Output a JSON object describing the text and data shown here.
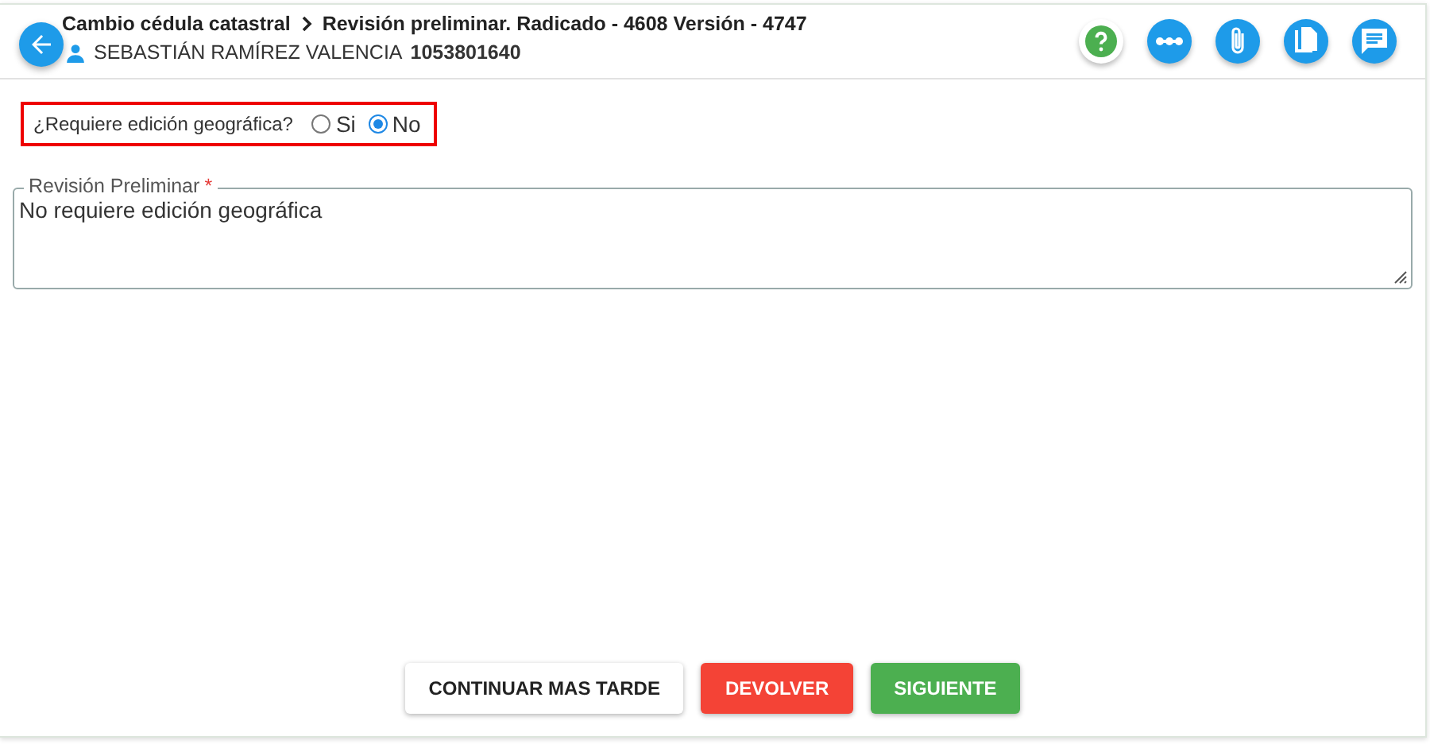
{
  "header": {
    "breadcrumb": [
      "Cambio cédula catastral",
      "Revisión preliminar. Radicado - 4608 Versión - 4747"
    ],
    "user_name": "SEBASTIÁN RAMÍREZ VALENCIA",
    "user_id": "1053801640",
    "actions": [
      {
        "kind": "help"
      },
      {
        "kind": "flow"
      },
      {
        "kind": "attach"
      },
      {
        "kind": "copy"
      },
      {
        "kind": "comment"
      }
    ]
  },
  "question": {
    "label": "¿Requiere edición geográfica?",
    "highlighted": true,
    "options": [
      {
        "label": "Si",
        "selected": false
      },
      {
        "label": "No",
        "selected": true
      }
    ]
  },
  "field": {
    "label": "Revisión Preliminar",
    "required_mark": "*",
    "value": "No requiere edición geográfica"
  },
  "buttons": [
    {
      "label": "CONTINUAR MAS TARDE",
      "kind": "default"
    },
    {
      "label": "DEVOLVER",
      "kind": "danger"
    },
    {
      "label": "SIGUIENTE",
      "kind": "success"
    }
  ]
}
